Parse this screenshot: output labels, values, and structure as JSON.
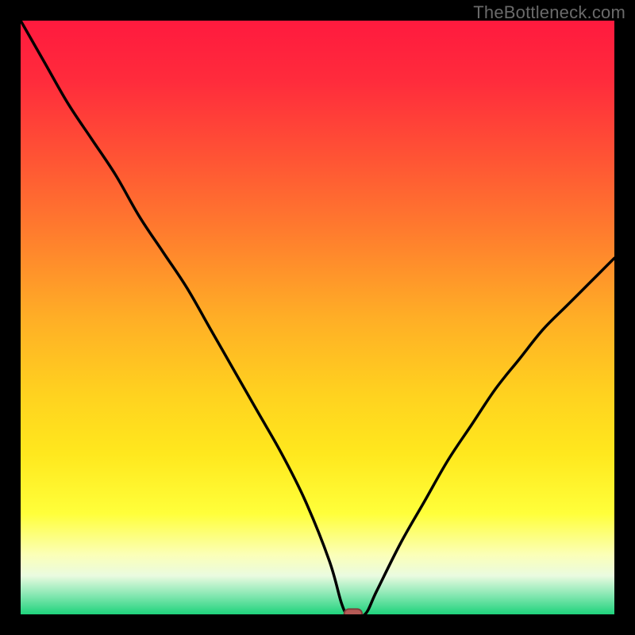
{
  "attribution": "TheBottleneck.com",
  "colors": {
    "frame": "#000000",
    "gradient_stops": [
      {
        "offset": 0.0,
        "color": "#ff1a3e"
      },
      {
        "offset": 0.1,
        "color": "#ff2b3c"
      },
      {
        "offset": 0.22,
        "color": "#ff5035"
      },
      {
        "offset": 0.35,
        "color": "#ff7a2e"
      },
      {
        "offset": 0.5,
        "color": "#ffae26"
      },
      {
        "offset": 0.63,
        "color": "#ffd21f"
      },
      {
        "offset": 0.73,
        "color": "#ffe81e"
      },
      {
        "offset": 0.83,
        "color": "#ffff3a"
      },
      {
        "offset": 0.9,
        "color": "#fbffb8"
      },
      {
        "offset": 0.935,
        "color": "#eafbe0"
      },
      {
        "offset": 0.965,
        "color": "#8ee9b6"
      },
      {
        "offset": 1.0,
        "color": "#1fd37c"
      }
    ],
    "curve_stroke": "#000000",
    "marker_fill": "#b55a56",
    "marker_stroke": "#7f3d3a"
  },
  "chart_data": {
    "type": "line",
    "title": "",
    "xlabel": "",
    "ylabel": "",
    "xlim": [
      0,
      100
    ],
    "ylim": [
      0,
      100
    ],
    "series": [
      {
        "name": "bottleneck-curve",
        "x": [
          0,
          4,
          8,
          12,
          16,
          20,
          24,
          28,
          32,
          36,
          40,
          44,
          48,
          52,
          54,
          55,
          56,
          58,
          60,
          64,
          68,
          72,
          76,
          80,
          84,
          88,
          92,
          96,
          100
        ],
        "y": [
          100,
          93,
          86,
          80,
          74,
          67,
          61,
          55,
          48,
          41,
          34,
          27,
          19,
          9,
          2,
          0,
          0,
          0,
          4,
          12,
          19,
          26,
          32,
          38,
          43,
          48,
          52,
          56,
          60
        ]
      }
    ],
    "marker": {
      "x": 56,
      "y": 0,
      "shape": "rounded-rect"
    }
  }
}
